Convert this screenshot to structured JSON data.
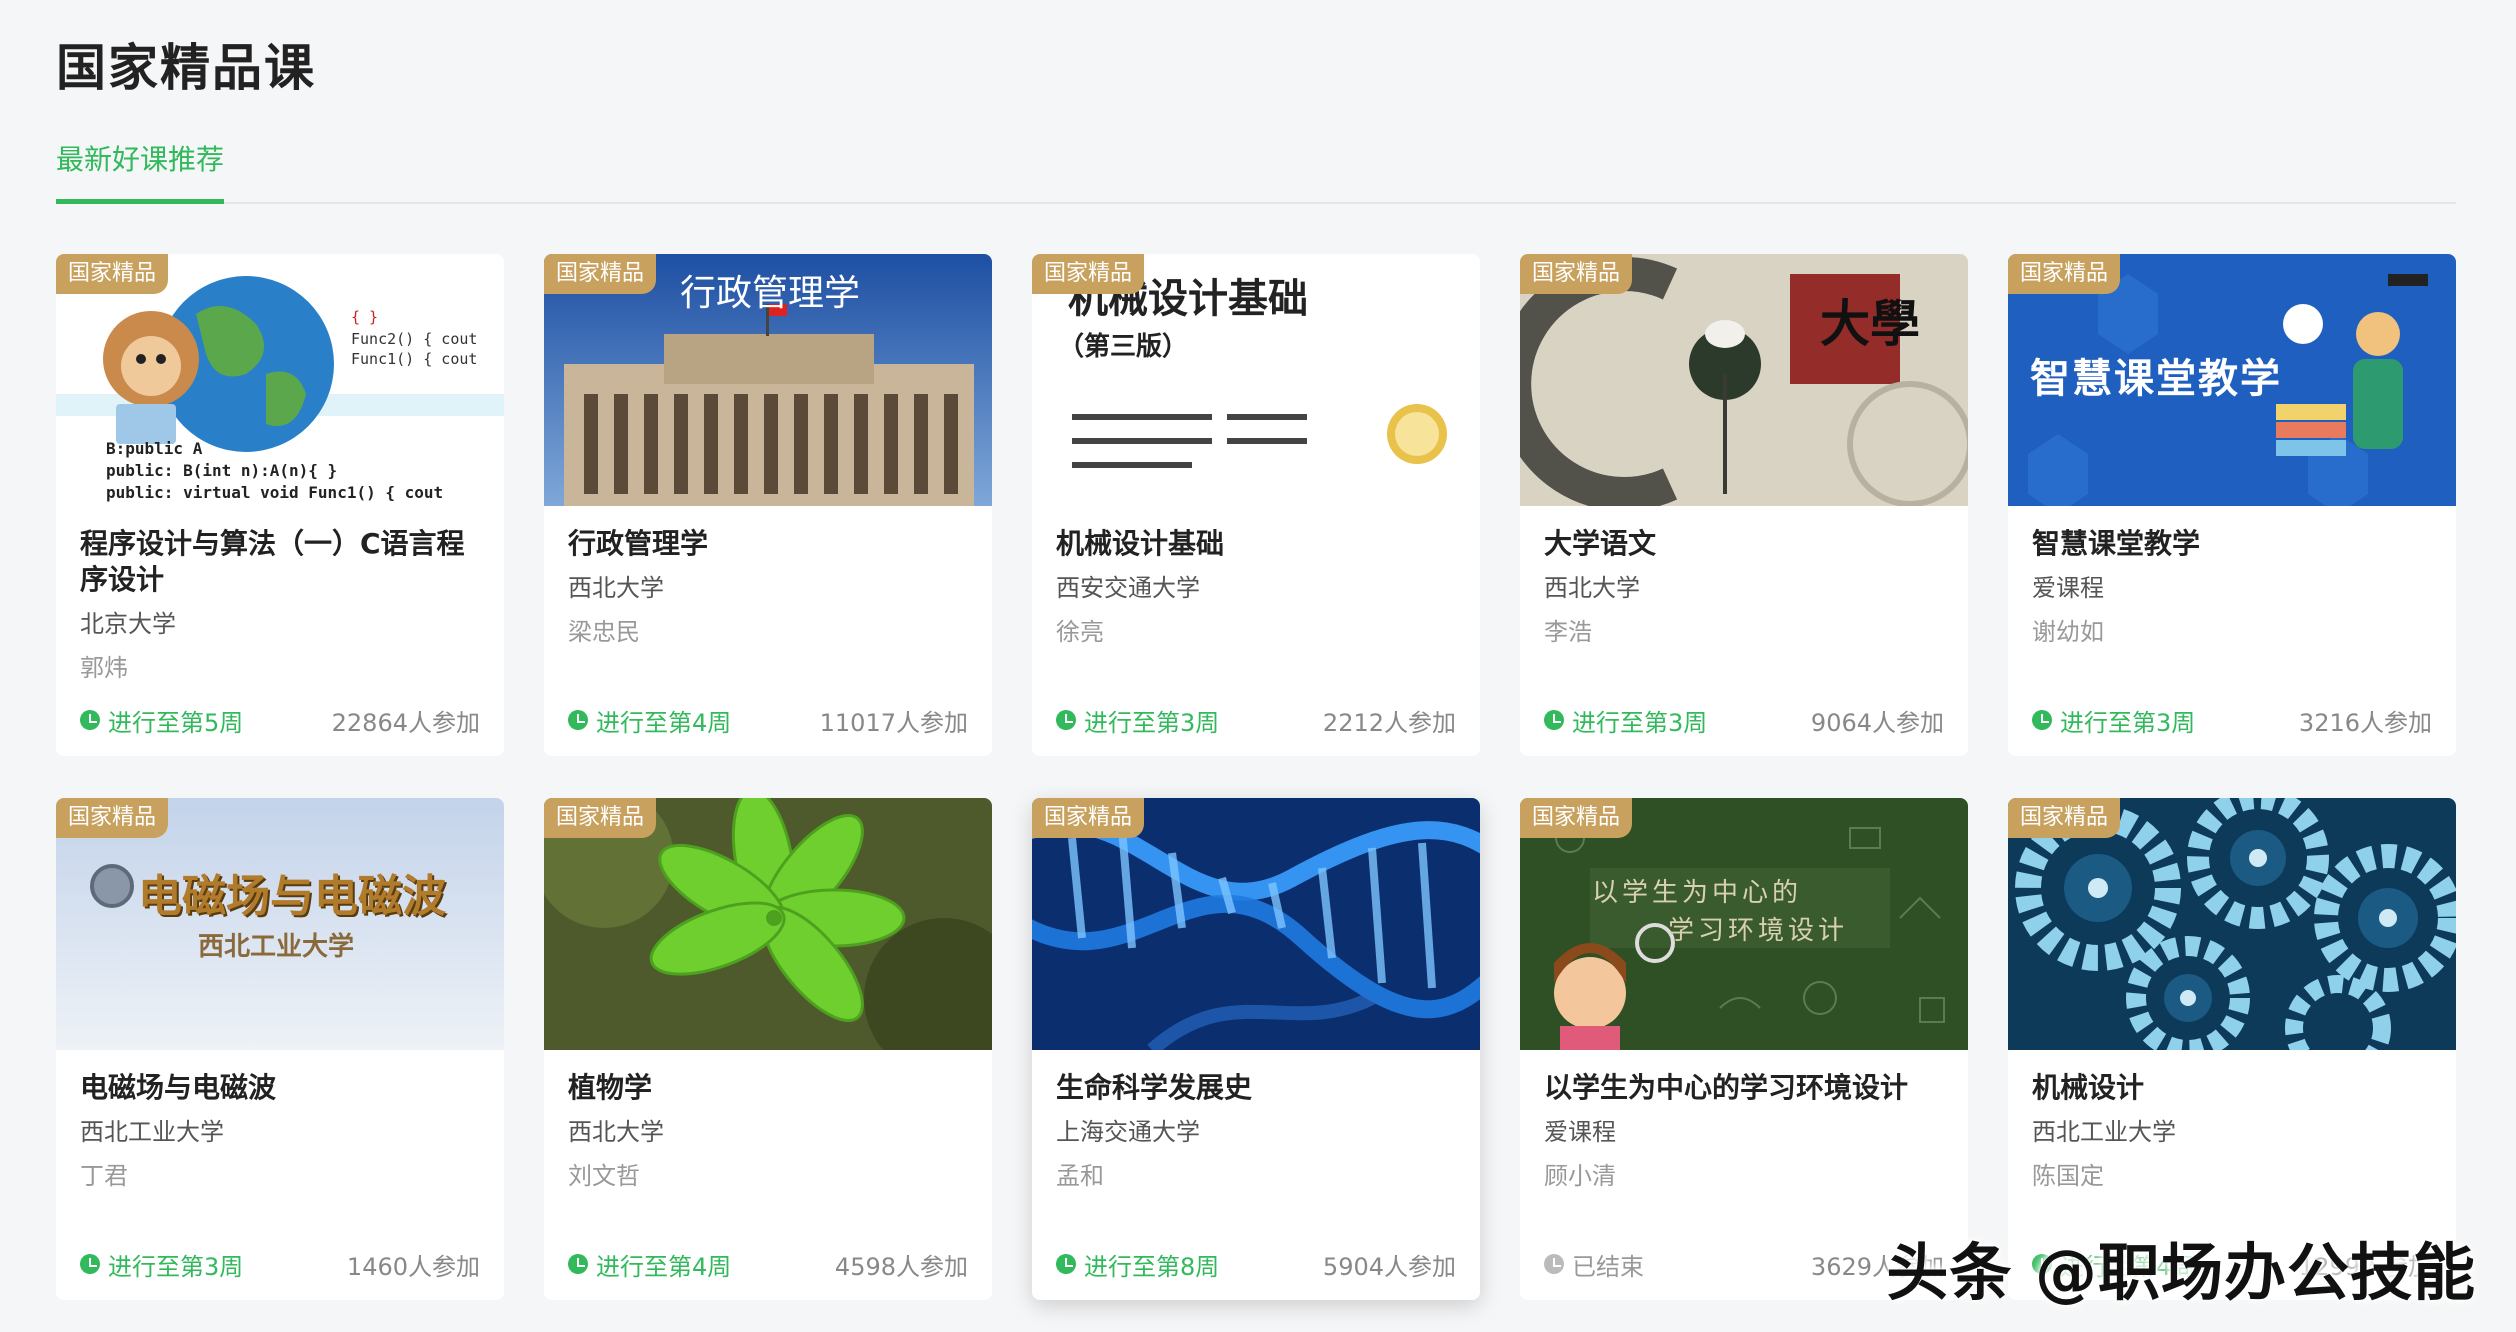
{
  "page": {
    "title": "国家精品课",
    "active_tab": "最新好课推荐",
    "badge_label": "国家精品"
  },
  "colors": {
    "accent": "#31b95b",
    "badge": "#c8a15f"
  },
  "courses": [
    {
      "title": "程序设计与算法（一）C语言程序设计",
      "school": "北京大学",
      "teacher": "郭炜",
      "status": "进行至第5周",
      "participants": "22864人参加",
      "thumb_text": ""
    },
    {
      "title": "行政管理学",
      "school": "西北大学",
      "teacher": "梁忠民",
      "status": "进行至第4周",
      "participants": "11017人参加",
      "thumb_text": "行政管理学"
    },
    {
      "title": "机械设计基础",
      "school": "西安交通大学",
      "teacher": "徐亮",
      "status": "进行至第3周",
      "participants": "2212人参加",
      "thumb_text": "机械设计基础",
      "thumb_sub": "（第三版）"
    },
    {
      "title": "大学语文",
      "school": "西北大学",
      "teacher": "李浩",
      "status": "进行至第3周",
      "participants": "9064人参加",
      "thumb_text": "大學"
    },
    {
      "title": "智慧课堂教学",
      "school": "爱课程",
      "teacher": "谢幼如",
      "status": "进行至第3周",
      "participants": "3216人参加",
      "thumb_text": "智慧课堂教学"
    },
    {
      "title": "电磁场与电磁波",
      "school": "西北工业大学",
      "teacher": "丁君",
      "status": "进行至第3周",
      "participants": "1460人参加",
      "thumb_text": "电磁场与电磁波",
      "thumb_sub": "西北工业大学"
    },
    {
      "title": "植物学",
      "school": "西北大学",
      "teacher": "刘文哲",
      "status": "进行至第4周",
      "participants": "4598人参加",
      "thumb_text": ""
    },
    {
      "title": "生命科学发展史",
      "school": "上海交通大学",
      "teacher": "孟和",
      "status": "进行至第8周",
      "participants": "5904人参加",
      "thumb_text": ""
    },
    {
      "title": "以学生为中心的学习环境设计",
      "school": "爱课程",
      "teacher": "顾小清",
      "status": "已结束",
      "participants": "3629人参加",
      "thumb_text": "以学生为中心的",
      "thumb_sub": "学习环境设计"
    },
    {
      "title": "机械设计",
      "school": "西北工业大学",
      "teacher": "陈国定",
      "status": "进行至第4周",
      "participants": "1299人参加",
      "thumb_text": ""
    }
  ],
  "watermark": "头条 @职场办公技能"
}
